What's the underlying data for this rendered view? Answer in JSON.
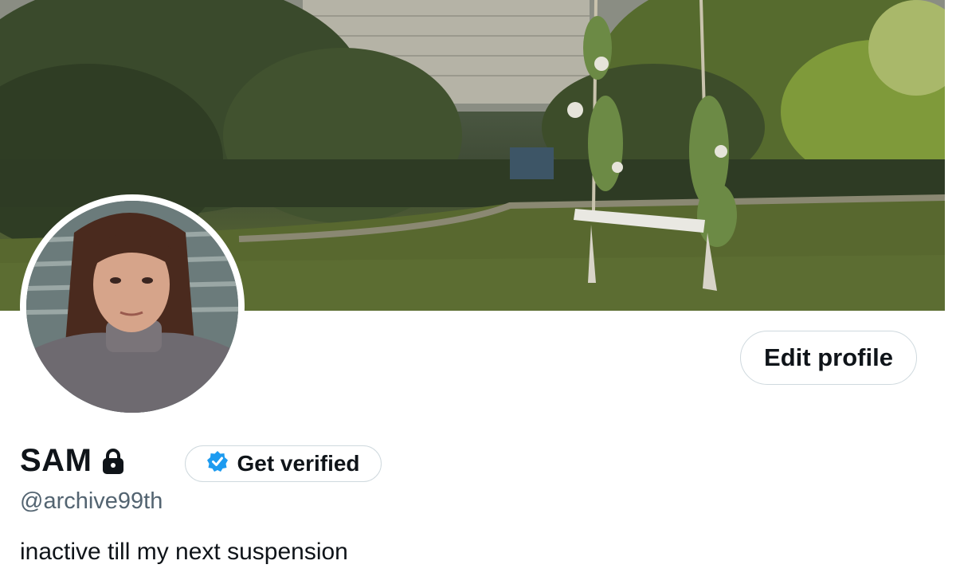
{
  "profile": {
    "display_name": "SAM",
    "handle": "@archive99th",
    "bio": "inactive till my next suspension",
    "protected_icon": "lock-icon"
  },
  "actions": {
    "edit_profile_label": "Edit profile",
    "get_verified_label": "Get verified",
    "verified_icon": "verified-badge-icon"
  },
  "colors": {
    "verified_blue": "#1d9bf0",
    "text_primary": "#0f1419",
    "text_secondary": "#536471",
    "button_border": "#cfd9de"
  }
}
